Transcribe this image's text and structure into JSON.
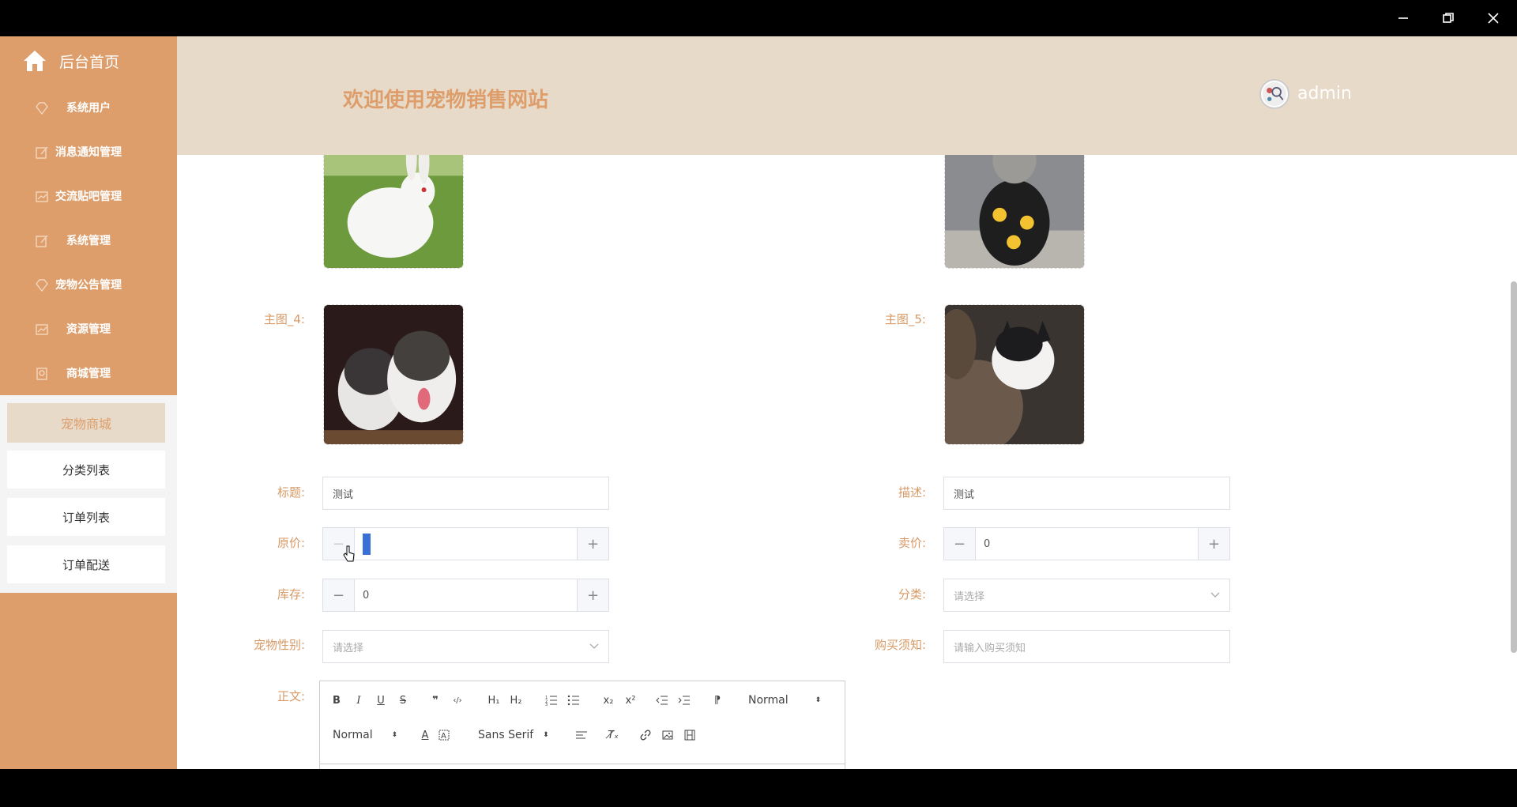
{
  "window": {
    "minimize_icon": "minimize-icon",
    "restore_icon": "restore-icon",
    "close_icon": "close-icon"
  },
  "sidebar": {
    "home_label": "后台首页",
    "items": [
      {
        "label": "系统用户",
        "icon": "diamond-icon"
      },
      {
        "label": "消息通知管理",
        "icon": "edit-icon"
      },
      {
        "label": "交流贴吧管理",
        "icon": "chart-icon"
      },
      {
        "label": "系统管理",
        "icon": "edit-icon"
      },
      {
        "label": "宠物公告管理",
        "icon": "diamond-icon"
      },
      {
        "label": "资源管理",
        "icon": "chart-icon"
      },
      {
        "label": "商城管理",
        "icon": "badge-icon"
      }
    ],
    "submenu": {
      "title": "宠物商城",
      "items": [
        "分类列表",
        "订单列表",
        "订单配送"
      ]
    }
  },
  "header": {
    "welcome": "欢迎使用宠物销售网站",
    "username": "admin"
  },
  "form": {
    "image4_label": "主图_4:",
    "image5_label": "主图_5:",
    "title_label": "标题:",
    "title_value": "测试",
    "desc_label": "描述:",
    "desc_value": "测试",
    "orig_price_label": "原价:",
    "orig_price_value": "0",
    "sale_price_label": "卖价:",
    "sale_price_value": "0",
    "stock_label": "库存:",
    "stock_value": "0",
    "category_label": "分类:",
    "category_placeholder": "请选择",
    "gender_label": "宠物性别:",
    "gender_placeholder": "请选择",
    "notice_label": "购买须知:",
    "notice_placeholder": "请输入购买须知",
    "body_label": "正文:",
    "minus": "−",
    "plus": "+"
  },
  "editor": {
    "bold": "B",
    "italic": "I",
    "underline": "U",
    "strike": "S",
    "quote": "❞",
    "code": "‹/›",
    "h1": "H₁",
    "h2": "H₂",
    "sub": "x₂",
    "sup": "x²",
    "rtl": "⁋",
    "header_select": "Normal",
    "size_select": "Normal",
    "font_select": "Sans Serif",
    "text_color": "A",
    "clear": "T̸ₓ"
  },
  "colors": {
    "sidebar": "#dd9e6c",
    "header": "#e8dac8",
    "accent": "#d79a66"
  }
}
